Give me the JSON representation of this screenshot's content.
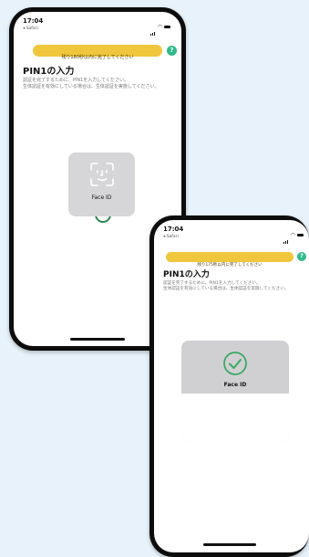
{
  "phone1": {
    "time": "17:04",
    "back_app": "◂ Safari",
    "timer_text": "残り180秒以内に完了してください",
    "help": "?",
    "title": "PIN1の入力",
    "desc1": "認証を完了するために、PIN1を入力してください。",
    "desc2": "生体認証を有効にしている場合は、生体認証を実施してください。",
    "faceid_label": "Face ID"
  },
  "phone2": {
    "time": "17:04",
    "back_app": "◂ Safari",
    "timer_text": "残り175秒以内に完了してください",
    "help": "?",
    "title": "PIN1の入力",
    "desc1": "認証を完了するために、PIN1を入力してください。",
    "desc2": "生体認証を有効にしている場合は、生体認証を実施してください。",
    "faceid_label": "Face ID"
  },
  "colors": {
    "background": "#e7f2fb",
    "timer_bar": "#f0c63d",
    "help_button": "#2fba8a",
    "check": "#3aa865"
  }
}
